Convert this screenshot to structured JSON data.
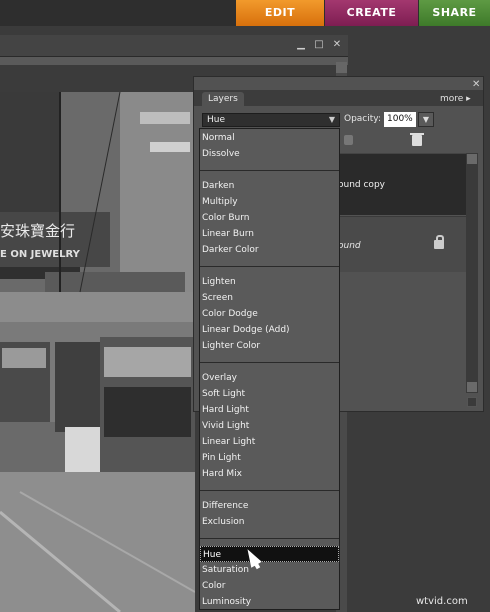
{
  "mode_tabs": {
    "edit": "EDIT",
    "create": "CREATE",
    "share": "SHARE"
  },
  "document_window": {
    "minimize": "▁",
    "maximize": "□",
    "close": "✕"
  },
  "photo": {
    "sign_text_line1": "安珠寶金行",
    "sign_text_line2": "E ON JEWELRY"
  },
  "layers_panel": {
    "close": "✕",
    "tab_label": "Layers",
    "more_label": "more ▸",
    "blend_mode_value": "Hue",
    "opacity_label": "Opacity:",
    "opacity_value": "100%",
    "layers": [
      {
        "name": "ound copy"
      },
      {
        "name": "ound"
      }
    ]
  },
  "blend_menu": {
    "groups": [
      [
        "Normal",
        "Dissolve"
      ],
      [
        "Darken",
        "Multiply",
        "Color Burn",
        "Linear Burn",
        "Darker Color"
      ],
      [
        "Lighten",
        "Screen",
        "Color Dodge",
        "Linear Dodge (Add)",
        "Lighter Color"
      ],
      [
        "Overlay",
        "Soft Light",
        "Hard Light",
        "Vivid Light",
        "Linear Light",
        "Pin Light",
        "Hard Mix"
      ],
      [
        "Difference",
        "Exclusion"
      ],
      [
        "Hue",
        "Saturation",
        "Color",
        "Luminosity"
      ]
    ],
    "selected": "Hue"
  },
  "watermark": "wtvid.com"
}
